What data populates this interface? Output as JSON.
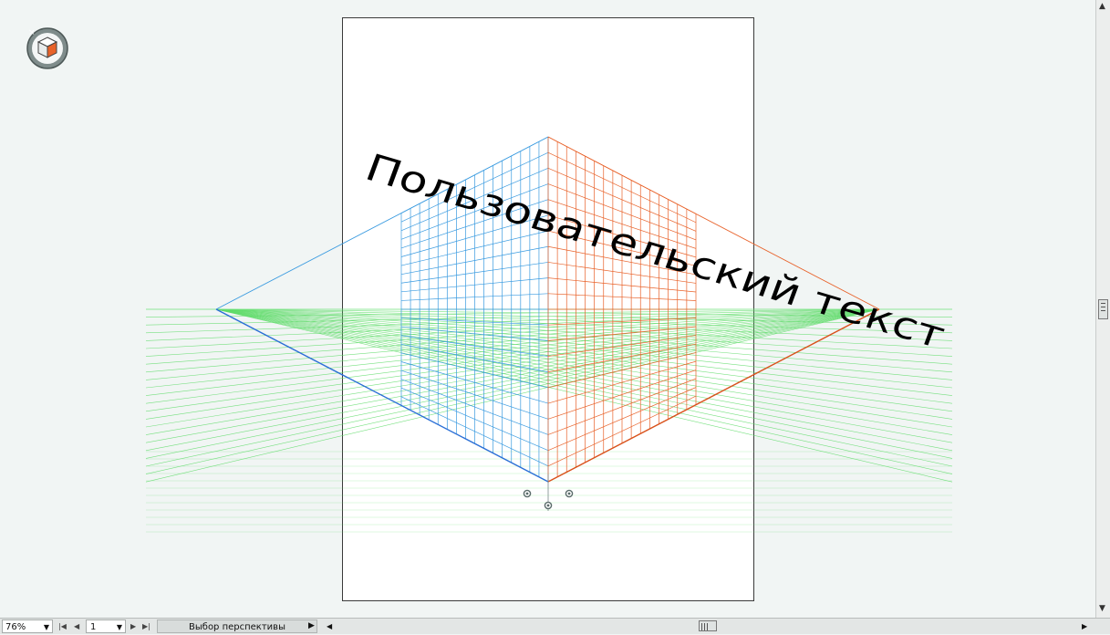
{
  "document": {
    "perspective_text": "Пользовательский текст"
  },
  "status_bar": {
    "zoom_value": "76%",
    "page_value": "1",
    "status_text": "Выбор перспективы"
  },
  "icons": {
    "perspective_widget": "perspective-grid-widget-icon",
    "first_page": "first-page-icon",
    "prev_page": "prev-page-icon",
    "next_page": "next-page-icon",
    "last_page": "last-page-icon",
    "dropdown": "chevron-down-icon",
    "status_menu": "play-right-icon",
    "scroll_left": "scroll-left-icon",
    "scroll_right": "scroll-right-icon",
    "scroll_up": "scroll-up-icon",
    "scroll_down": "scroll-down-icon"
  },
  "colors": {
    "left_plane": "#3a9be0",
    "right_plane": "#e8622a",
    "ground_plane": "#5fdc6a",
    "artboard_border": "#3a3a3a"
  }
}
